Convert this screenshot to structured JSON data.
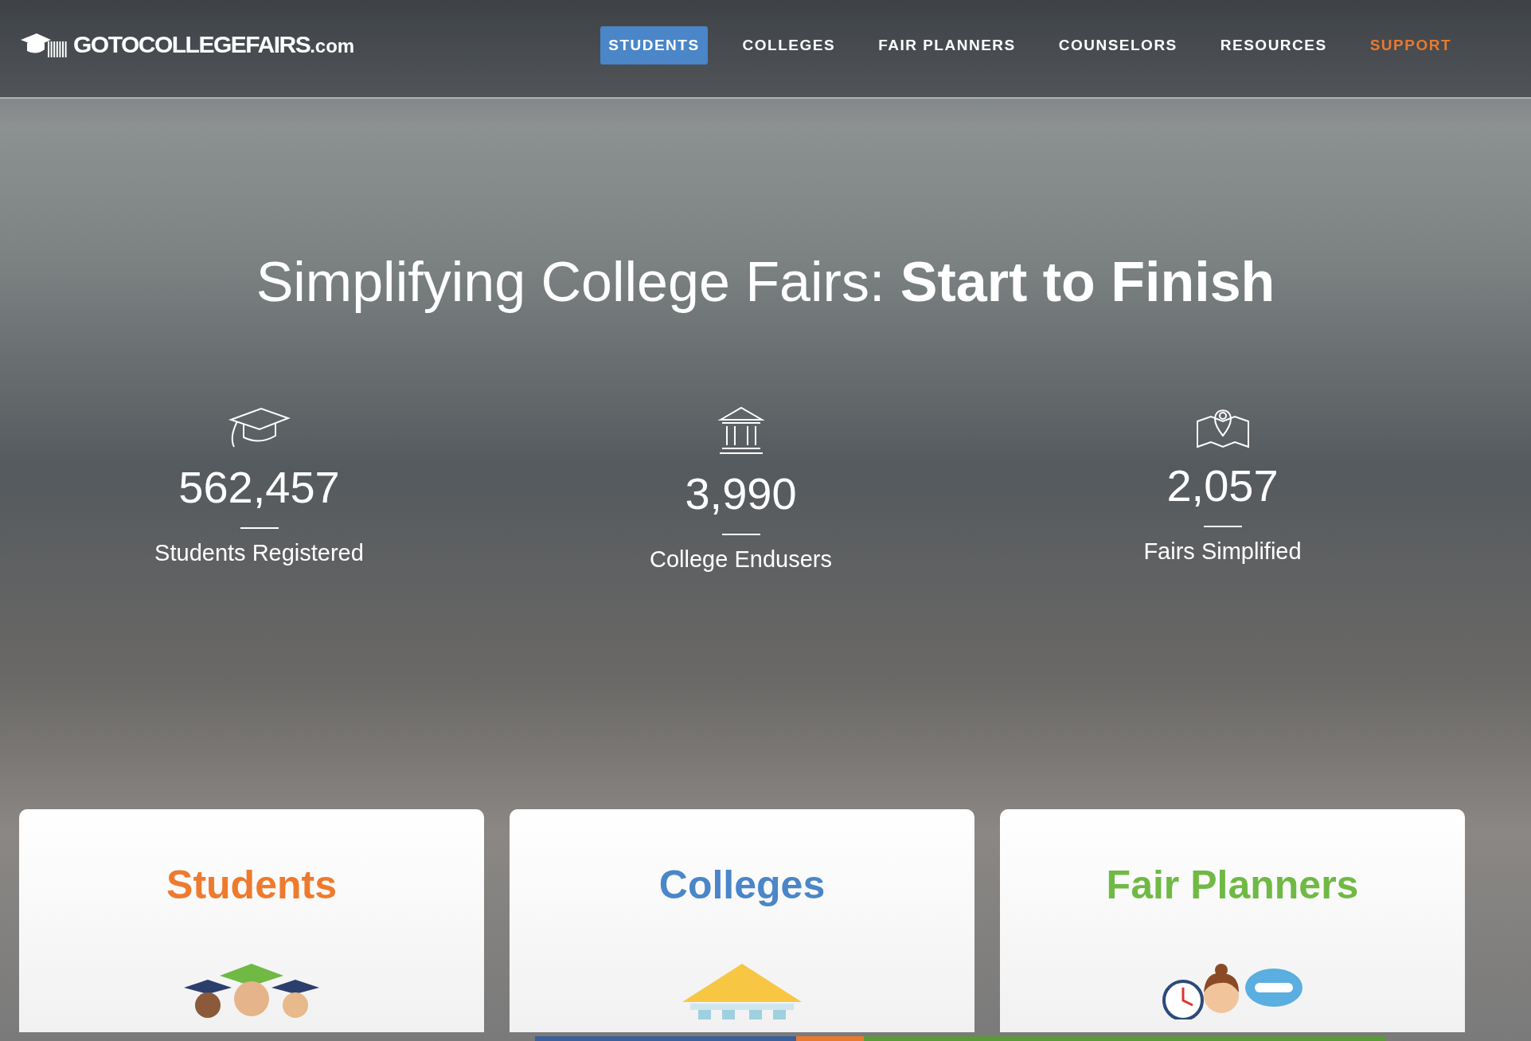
{
  "logo": {
    "text": "GOTOCOLLEGEFAIRS",
    "suffix": ".com"
  },
  "nav": [
    {
      "label": "STUDENTS",
      "selected": true,
      "kind": "link"
    },
    {
      "label": "COLLEGES",
      "selected": false,
      "kind": "link"
    },
    {
      "label": "FAIR PLANNERS",
      "selected": false,
      "kind": "link"
    },
    {
      "label": "COUNSELORS",
      "selected": false,
      "kind": "link"
    },
    {
      "label": "RESOURCES",
      "selected": false,
      "kind": "link"
    },
    {
      "label": "SUPPORT",
      "selected": false,
      "kind": "support"
    }
  ],
  "hero": {
    "title": "Simplifying College Fairs: **Start to Finish**"
  },
  "stats": [
    {
      "kind": "cap",
      "value": "562,457",
      "label": "Students Registered"
    },
    {
      "kind": "building",
      "value": "3,990",
      "label": "College Endusers"
    },
    {
      "kind": "map",
      "value": "2,057",
      "label": "Fairs Simplified"
    }
  ],
  "cards": [
    {
      "kind": "students",
      "title": "Students",
      "color": "#ee7a2e"
    },
    {
      "kind": "colleges",
      "title": "Colleges",
      "color": "#4a86c8"
    },
    {
      "kind": "planners",
      "title": "Fair Planners",
      "color": "#6fb944"
    }
  ]
}
